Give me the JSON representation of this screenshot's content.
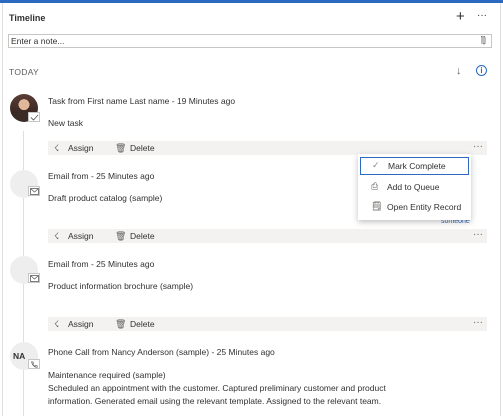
{
  "header": {
    "title": "Timeline",
    "add_icon": "plus-icon",
    "more_icon": "more-icon"
  },
  "note": {
    "placeholder": "Enter a note..."
  },
  "section": {
    "label": "TODAY"
  },
  "menu": {
    "items": [
      {
        "label": "Mark Complete",
        "icon": "check-icon"
      },
      {
        "label": "Add to Queue",
        "icon": "queue-icon"
      },
      {
        "label": "Open Entity Record",
        "icon": "record-icon"
      }
    ]
  },
  "partial_text": "someone",
  "actions": {
    "assign": "Assign",
    "delete": "Delete"
  },
  "activities": [
    {
      "type": "task",
      "prefix": "Task from ",
      "from": "First name Last name",
      "time": " - 19 Minutes ago",
      "title": "New task"
    },
    {
      "type": "email",
      "prefix": "Email from",
      "from": "",
      "time": " - 25 Minutes ago",
      "title": "Draft product catalog (sample)"
    },
    {
      "type": "email",
      "prefix": "Email from",
      "from": "",
      "time": " - 25 Minutes ago",
      "title": "Product information brochure (sample)"
    },
    {
      "type": "phone",
      "initials": "NA",
      "prefix": "Phone Call from ",
      "from": "Nancy Anderson (sample)",
      "time": " - 25 Minutes ago",
      "title": "Maintenance required (sample)",
      "description_line1": "Scheduled an appointment with the customer. Captured preliminary customer and product",
      "description_line2": "information. Generated email using the relevant template. Assigned to the relevant team."
    }
  ]
}
